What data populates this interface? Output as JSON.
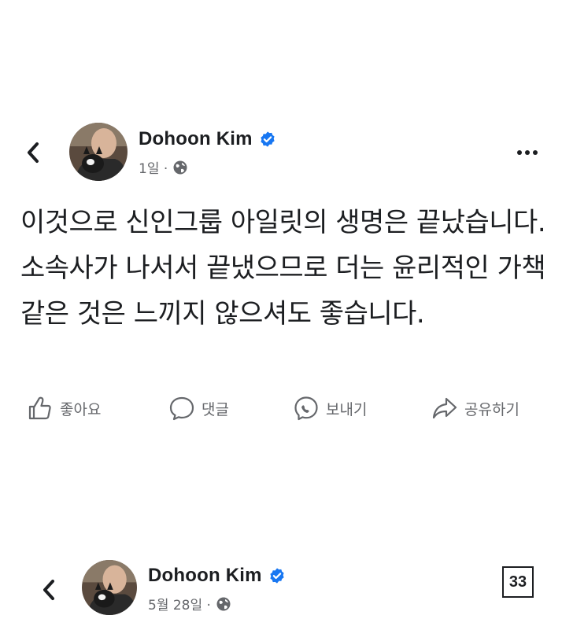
{
  "posts": [
    {
      "author": "Dohoon Kim",
      "time": "1일 ·",
      "text": "이것으로 신인그룹 아일릿의 생명은 끝났습니다. 소속사가 나서서 끝냈으므로 더는 윤리적인 가책 같은 것은 느끼지 않으셔도 좋습니다.",
      "actions": {
        "like": "좋아요",
        "comment": "댓글",
        "send": "보내기",
        "share": "공유하기"
      }
    },
    {
      "author": "Dohoon Kim",
      "time": "5월 28일 ·"
    }
  ],
  "page_badge": "33",
  "icons": {
    "back": "chevron-left-icon",
    "verified": "verified-badge-icon",
    "audience": "globe-icon",
    "more": "more-horizontal-icon",
    "like": "thumbs-up-icon",
    "comment": "comment-bubble-icon",
    "send": "messenger-icon",
    "share": "share-arrow-icon"
  },
  "colors": {
    "text_primary": "#1c1e21",
    "text_secondary": "#65676b",
    "verified_blue": "#1877f2",
    "background": "#ffffff"
  }
}
